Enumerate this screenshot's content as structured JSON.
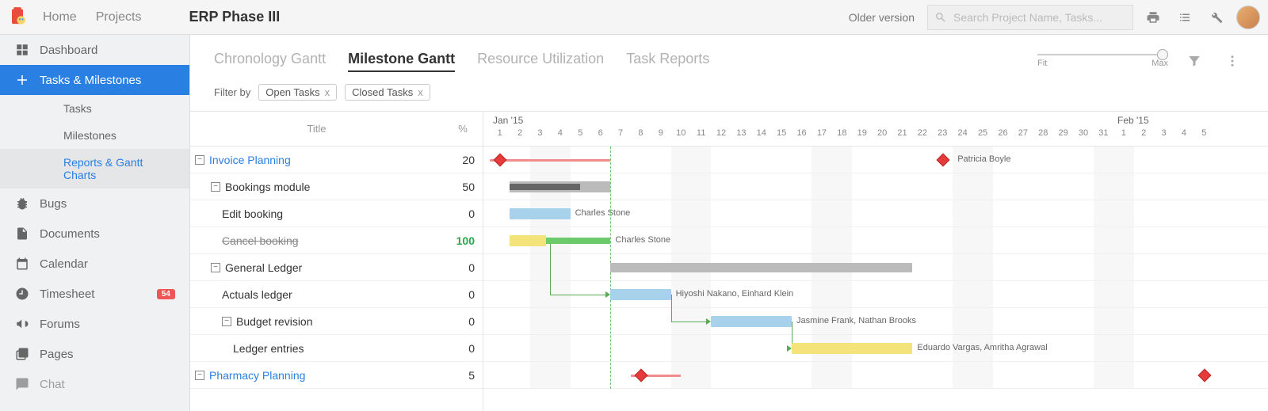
{
  "nav": {
    "home": "Home",
    "projects": "Projects"
  },
  "project_title": "ERP Phase III",
  "older_version": "Older version",
  "search": {
    "placeholder": "Search Project Name, Tasks..."
  },
  "sidebar": {
    "dashboard": "Dashboard",
    "tasks_milestones": "Tasks & Milestones",
    "tasks": "Tasks",
    "milestones": "Milestones",
    "reports": "Reports & Gantt Charts",
    "bugs": "Bugs",
    "documents": "Documents",
    "calendar": "Calendar",
    "timesheet": "Timesheet",
    "timesheet_badge": "54",
    "forums": "Forums",
    "pages": "Pages",
    "chat": "Chat"
  },
  "tabs": {
    "chronology": "Chronology Gantt",
    "milestone": "Milestone Gantt",
    "resource": "Resource Utilization",
    "task_reports": "Task Reports"
  },
  "zoom": {
    "fit": "Fit",
    "max": "Max"
  },
  "filter": {
    "label": "Filter by",
    "open": "Open Tasks",
    "closed": "Closed Tasks"
  },
  "table_head": {
    "title": "Title",
    "pct": "%"
  },
  "timeline": {
    "month1": "Jan '15",
    "month2": "Feb '15",
    "days": [
      "1",
      "2",
      "3",
      "4",
      "5",
      "6",
      "7",
      "8",
      "9",
      "10",
      "11",
      "12",
      "13",
      "14",
      "15",
      "16",
      "17",
      "18",
      "19",
      "20",
      "21",
      "22",
      "23",
      "24",
      "25",
      "26",
      "27",
      "28",
      "29",
      "30",
      "31",
      "1",
      "2",
      "3",
      "4",
      "5"
    ]
  },
  "rows": [
    {
      "title": "Invoice Planning",
      "pct": "20",
      "class": "milestone-link",
      "toggle": "−",
      "indent": 0
    },
    {
      "title": "Bookings module",
      "pct": "50",
      "toggle": "−",
      "indent": 1
    },
    {
      "title": "Edit booking",
      "pct": "0",
      "indent": 2
    },
    {
      "title": "Cancel booking",
      "pct": "100",
      "pct_class": "green",
      "title_class": "strike",
      "indent": 2
    },
    {
      "title": "General Ledger",
      "pct": "0",
      "toggle": "−",
      "indent": 1
    },
    {
      "title": "Actuals ledger",
      "pct": "0",
      "indent": 2
    },
    {
      "title": "Budget revision",
      "pct": "0",
      "toggle": "−",
      "indent": 2
    },
    {
      "title": "Ledger entries",
      "pct": "0",
      "indent": 3
    },
    {
      "title": "Pharmacy Planning",
      "pct": "5",
      "class": "milestone-link",
      "toggle": "−",
      "indent": 0
    }
  ],
  "assignees": {
    "patricia": "Patricia Boyle",
    "charles1": "Charles Stone",
    "charles2": "Charles Stone",
    "hiyoshi": "Hiyoshi Nakano, Einhard Klein",
    "jasmine": "Jasmine Frank, Nathan Brooks",
    "eduardo": "Eduardo Vargas, Amritha Agrawal"
  },
  "chart_data": {
    "type": "gantt",
    "x_unit": "day",
    "x_start": "2015-01-01",
    "x_end": "2015-02-05",
    "today": "2015-01-07",
    "weekends": [
      3,
      4,
      10,
      11,
      17,
      18,
      24,
      25,
      31,
      32
    ],
    "rows": [
      {
        "name": "Invoice Planning",
        "milestone_start": 1,
        "milestone_end": 23,
        "bar": {
          "kind": "red",
          "start": 1,
          "end": 6
        },
        "assignee": "Patricia Boyle"
      },
      {
        "name": "Bookings module",
        "bar": {
          "kind": "progress",
          "start": 2,
          "end": 6,
          "done_end": 4.5
        }
      },
      {
        "name": "Edit booking",
        "bar": {
          "kind": "blue",
          "start": 2,
          "end": 4
        },
        "assignee": "Charles Stone"
      },
      {
        "name": "Cancel booking",
        "bars": [
          {
            "kind": "green",
            "start": 2,
            "end": 6
          },
          {
            "kind": "yellow",
            "start": 2,
            "end": 2.8
          }
        ],
        "assignee": "Charles Stone"
      },
      {
        "name": "General Ledger",
        "bar": {
          "kind": "grey",
          "start": 7,
          "end": 21
        }
      },
      {
        "name": "Actuals ledger",
        "bar": {
          "kind": "blue",
          "start": 7,
          "end": 9
        },
        "assignee": "Hiyoshi Nakano, Einhard Klein"
      },
      {
        "name": "Budget revision",
        "bar": {
          "kind": "blue",
          "start": 12,
          "end": 15
        },
        "assignee": "Jasmine Frank, Nathan Brooks"
      },
      {
        "name": "Ledger entries",
        "bar": {
          "kind": "yellow",
          "start": 16,
          "end": 21
        },
        "assignee": "Eduardo Vargas, Amritha Agrawal"
      },
      {
        "name": "Pharmacy Planning",
        "milestone_start": 8,
        "milestone_end": 36,
        "bar": {
          "kind": "red",
          "start": 8,
          "end": 9.5
        }
      }
    ],
    "dependencies": [
      {
        "from_row": 3,
        "from_day": 3,
        "to_row": 5,
        "to_day": 7
      },
      {
        "from_row": 5,
        "from_day": 9,
        "to_row": 6,
        "to_day": 12
      },
      {
        "from_row": 6,
        "from_day": 15,
        "to_row": 7,
        "to_day": 16
      }
    ]
  }
}
